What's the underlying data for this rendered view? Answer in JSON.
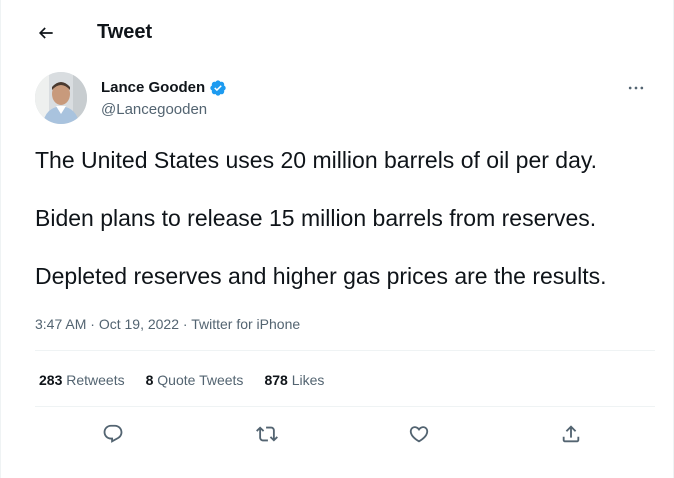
{
  "header": {
    "title": "Tweet",
    "back_icon": "arrow-left-icon"
  },
  "author": {
    "display_name": "Lance Gooden",
    "handle": "@Lancegooden",
    "verified_icon": "verified-badge-icon",
    "more_icon": "more-horizontal-icon"
  },
  "tweet": {
    "lines": [
      "The United States uses 20 million barrels of oil per day.",
      "Biden plans to release 15 million barrels from reserves.",
      "Depleted reserves and higher gas prices are the results."
    ],
    "time": "3:47 AM",
    "date": "Oct 19, 2022",
    "separator": "·",
    "source": "Twitter for iPhone"
  },
  "stats": {
    "retweets": {
      "count": "283",
      "label": "Retweets"
    },
    "quotes": {
      "count": "8",
      "label": "Quote Tweets"
    },
    "likes": {
      "count": "878",
      "label": "Likes"
    }
  },
  "actions": {
    "reply_icon": "reply-icon",
    "retweet_icon": "retweet-icon",
    "like_icon": "heart-icon",
    "share_icon": "share-icon"
  },
  "colors": {
    "text": "#0f1419",
    "secondary": "#536471",
    "divider": "#eff3f4",
    "verified": "#1d9bf0"
  }
}
